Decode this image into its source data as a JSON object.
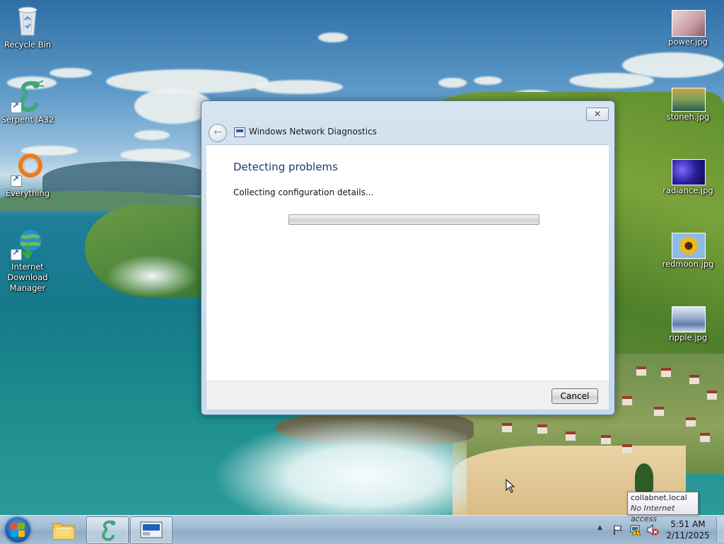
{
  "desktop": {
    "left_icons": [
      {
        "name": "recycle-bin",
        "label": "Recycle Bin"
      },
      {
        "name": "serpent-ia32",
        "label": "Serpent IA32"
      },
      {
        "name": "everything",
        "label": "Everything"
      },
      {
        "name": "internet-download-manager",
        "label": "Internet Download Manager"
      }
    ],
    "right_icons": [
      {
        "name": "power-jpg",
        "label": "power.jpg"
      },
      {
        "name": "stoneh-jpg",
        "label": "stoneh.jpg"
      },
      {
        "name": "radiance-jpg",
        "label": "radiance.jpg"
      },
      {
        "name": "redmoon-jpg",
        "label": "redmoon.jpg"
      },
      {
        "name": "ripple-jpg",
        "label": "ripple.jpg"
      }
    ]
  },
  "dialog": {
    "title": "Windows Network Diagnostics",
    "close_label": "✕",
    "back_label": "←",
    "heading": "Detecting problems",
    "status": "Collecting configuration details...",
    "progress_fraction": 0.0,
    "cancel_label": "Cancel"
  },
  "taskbar": {
    "clock_time": "5:51 AM",
    "clock_date": "2/11/2025",
    "tray_arrow": "▲"
  },
  "tooltip": {
    "line1": "collabnet.local",
    "line2": "No Internet access"
  },
  "colors": {
    "dialog_heading": "#1e3a6e",
    "taskbar": "#9fbad2",
    "progress_green": "#4ea72e"
  }
}
